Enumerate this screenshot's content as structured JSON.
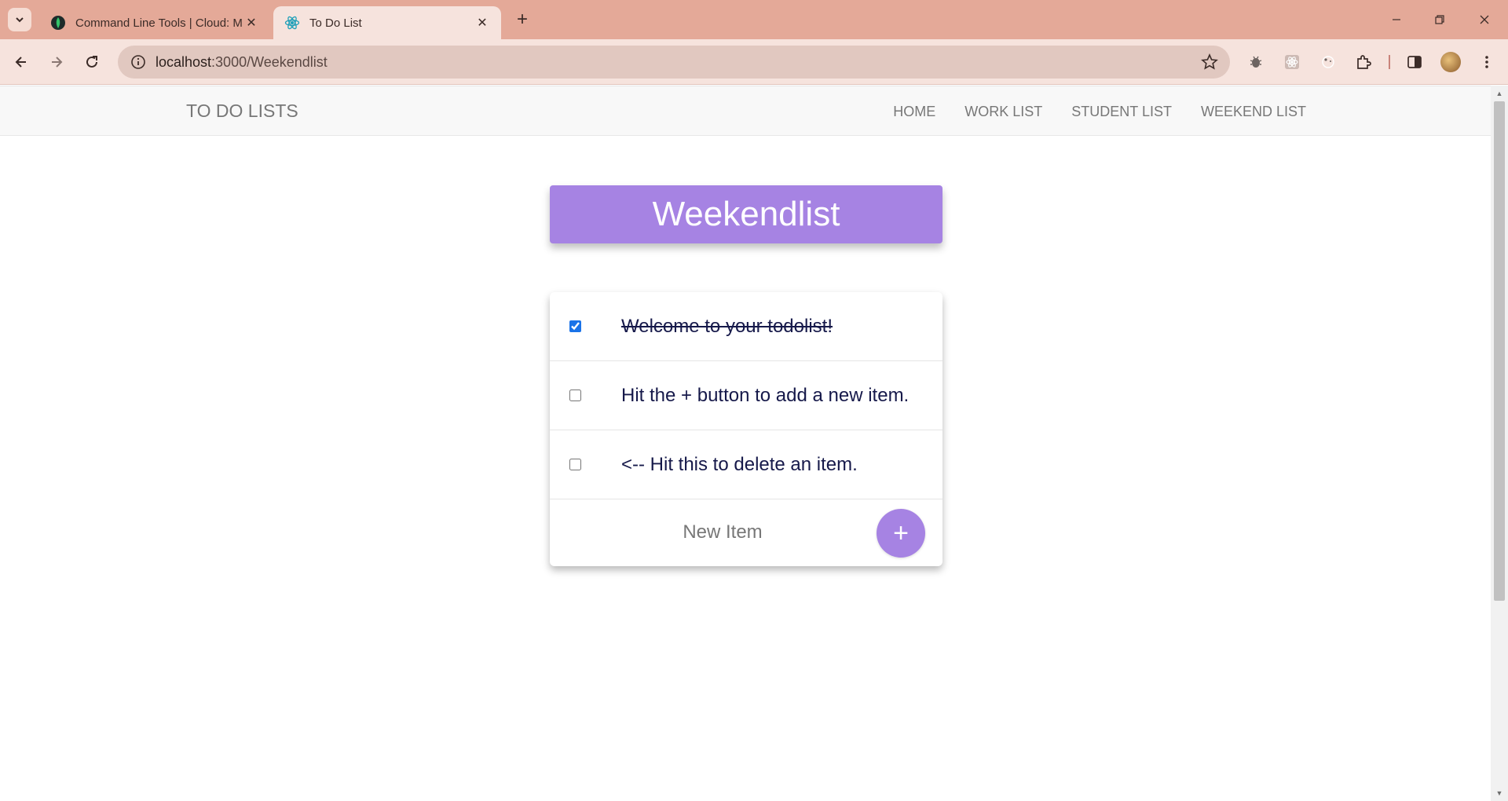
{
  "browser": {
    "tabs": [
      {
        "title": "Command Line Tools | Cloud: M",
        "icon": "mongodb-leaf-icon",
        "active": false
      },
      {
        "title": "To Do List",
        "icon": "react-icon",
        "active": true
      }
    ],
    "url_host": "localhost",
    "url_path": ":3000/Weekendlist"
  },
  "site": {
    "brand": "TO DO LISTS",
    "nav": [
      "HOME",
      "WORK LIST",
      "STUDENT LIST",
      "WEEKEND LIST"
    ]
  },
  "list": {
    "title": "Weekendlist",
    "items": [
      {
        "text": "Welcome to your todolist!",
        "checked": true
      },
      {
        "text": "Hit the + button to add a new item.",
        "checked": false
      },
      {
        "text": "<-- Hit this to delete an item.",
        "checked": false
      }
    ],
    "new_item_placeholder": "New Item",
    "add_label": "+"
  },
  "colors": {
    "accent": "#a683e3",
    "item_text": "#16194a",
    "tabbar": "#e4a998"
  }
}
